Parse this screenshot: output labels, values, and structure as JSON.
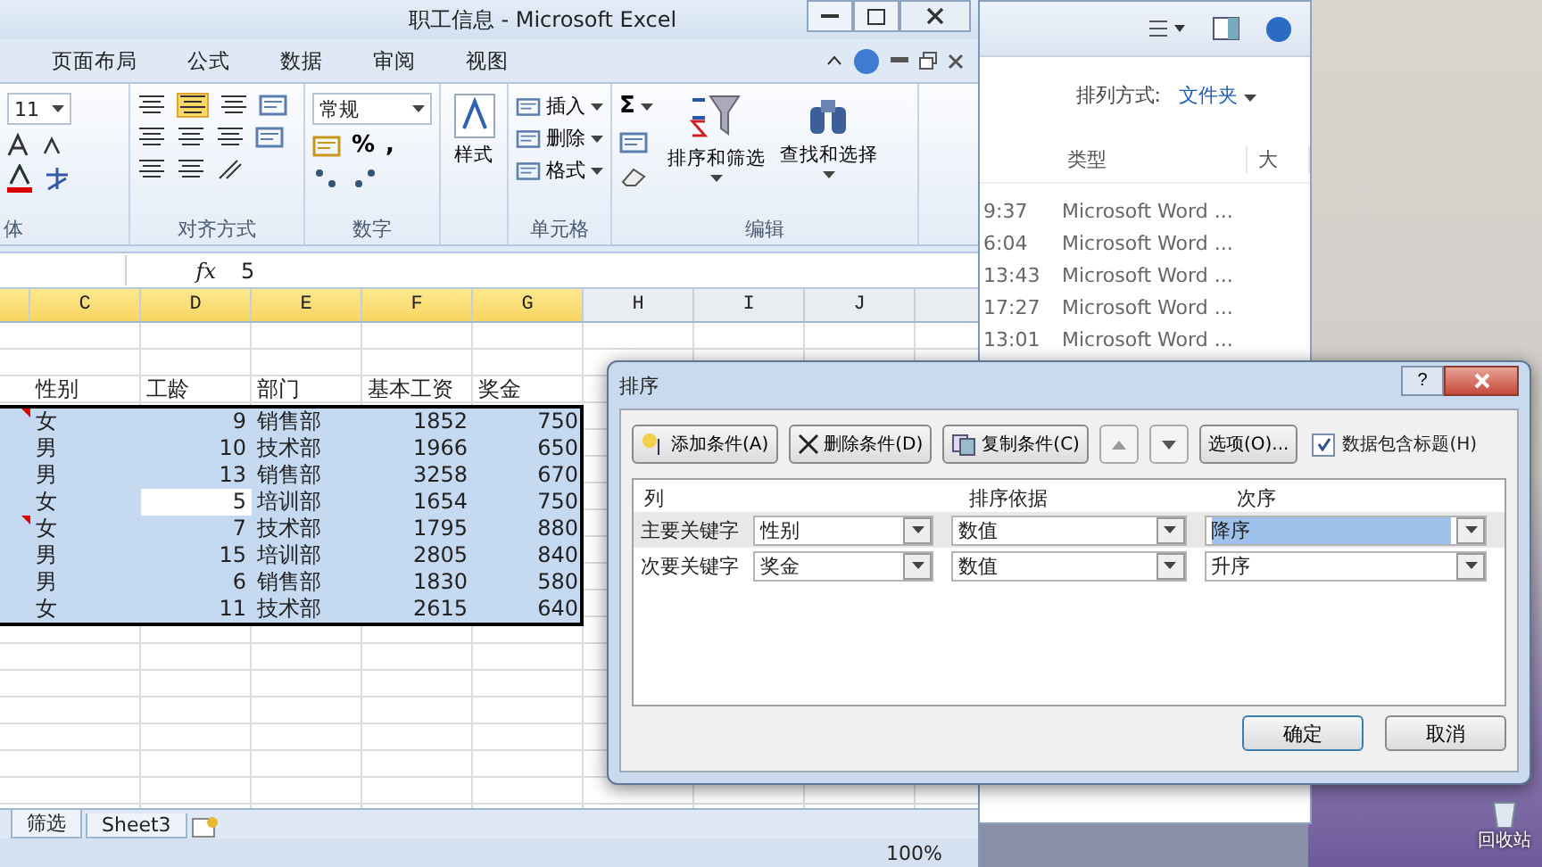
{
  "excel": {
    "title": "职工信息 - Microsoft Excel",
    "tabs": [
      {
        "label": "页面布局",
        "selected": false
      },
      {
        "label": "公式",
        "selected": false
      },
      {
        "label": "数据",
        "selected": false
      },
      {
        "label": "审阅",
        "selected": false
      },
      {
        "label": "视图",
        "selected": false
      }
    ],
    "ribbon": {
      "font": {
        "size": "11",
        "label": "体"
      },
      "alignment": {
        "label": "对齐方式"
      },
      "number": {
        "format": "常规",
        "percent": "%",
        "comma": ",",
        "label": "数字"
      },
      "styles": {
        "button": "样式"
      },
      "cells": {
        "items": [
          "插入",
          "删除",
          "格式"
        ],
        "label": "单元格"
      },
      "editing": {
        "sum": "Σ",
        "sort": "排序和筛选",
        "find": "查找和选择",
        "label": "编辑"
      }
    },
    "formula_bar": {
      "fx": "fx",
      "value": "5"
    },
    "columns": [
      {
        "label": "C",
        "selected": true
      },
      {
        "label": "D",
        "selected": true
      },
      {
        "label": "E",
        "selected": true
      },
      {
        "label": "F",
        "selected": true
      },
      {
        "label": "G",
        "selected": true
      },
      {
        "label": "H",
        "selected": false
      },
      {
        "label": "I",
        "selected": false
      },
      {
        "label": "J",
        "selected": false
      }
    ],
    "header_row": [
      "性别",
      "工龄",
      "部门",
      "基本工资",
      "奖金"
    ],
    "rows": [
      {
        "gender": "女",
        "years": "9",
        "dept": "销售部",
        "salary": "1852",
        "bonus": "750",
        "comment": true,
        "active": false
      },
      {
        "gender": "男",
        "years": "10",
        "dept": "技术部",
        "salary": "1966",
        "bonus": "650",
        "comment": false,
        "active": false
      },
      {
        "gender": "男",
        "years": "13",
        "dept": "销售部",
        "salary": "3258",
        "bonus": "670",
        "comment": false,
        "active": false
      },
      {
        "gender": "女",
        "years": "5",
        "dept": "培训部",
        "salary": "1654",
        "bonus": "750",
        "comment": false,
        "active": true
      },
      {
        "gender": "女",
        "years": "7",
        "dept": "技术部",
        "salary": "1795",
        "bonus": "880",
        "comment": true,
        "active": false
      },
      {
        "gender": "男",
        "years": "15",
        "dept": "培训部",
        "salary": "2805",
        "bonus": "840",
        "comment": false,
        "active": false
      },
      {
        "gender": "男",
        "years": "6",
        "dept": "销售部",
        "salary": "1830",
        "bonus": "580",
        "comment": false,
        "active": false
      },
      {
        "gender": "女",
        "years": "11",
        "dept": "技术部",
        "salary": "2615",
        "bonus": "640",
        "comment": false,
        "active": false
      }
    ],
    "sheet_tabs": [
      "筛选",
      "Sheet3"
    ],
    "zoom": "100%"
  },
  "explorer": {
    "sort_label": "排列方式:",
    "sort_value": "文件夹",
    "columns": [
      "类型",
      "大"
    ],
    "rows": [
      {
        "time": "9:37",
        "type": "Microsoft Word ..."
      },
      {
        "time": "6:04",
        "type": "Microsoft Word ..."
      },
      {
        "time": "13:43",
        "type": "Microsoft Word ..."
      },
      {
        "time": "17:27",
        "type": "Microsoft Word ..."
      },
      {
        "time": "13:01",
        "type": "Microsoft Word ..."
      }
    ]
  },
  "dialog": {
    "title": "排序",
    "help": "?",
    "toolbar": [
      {
        "kind": "add",
        "label": "添加条件(A)"
      },
      {
        "kind": "delete",
        "label": "删除条件(D)"
      },
      {
        "kind": "copy",
        "label": "复制条件(C)"
      }
    ],
    "options": "选项(O)...",
    "has_headers": {
      "label": "数据包含标题(H)",
      "checked": true
    },
    "headers": [
      "列",
      "排序依据",
      "次序"
    ],
    "levels": [
      {
        "label": "主要关键字",
        "column": "性别",
        "sort_on": "数值",
        "order": "降序",
        "selected": true
      },
      {
        "label": "次要关键字",
        "column": "奖金",
        "sort_on": "数值",
        "order": "升序",
        "selected": false
      }
    ],
    "ok": "确定",
    "cancel": "取消"
  },
  "desktop": {
    "recycle_bin": "回收站"
  }
}
